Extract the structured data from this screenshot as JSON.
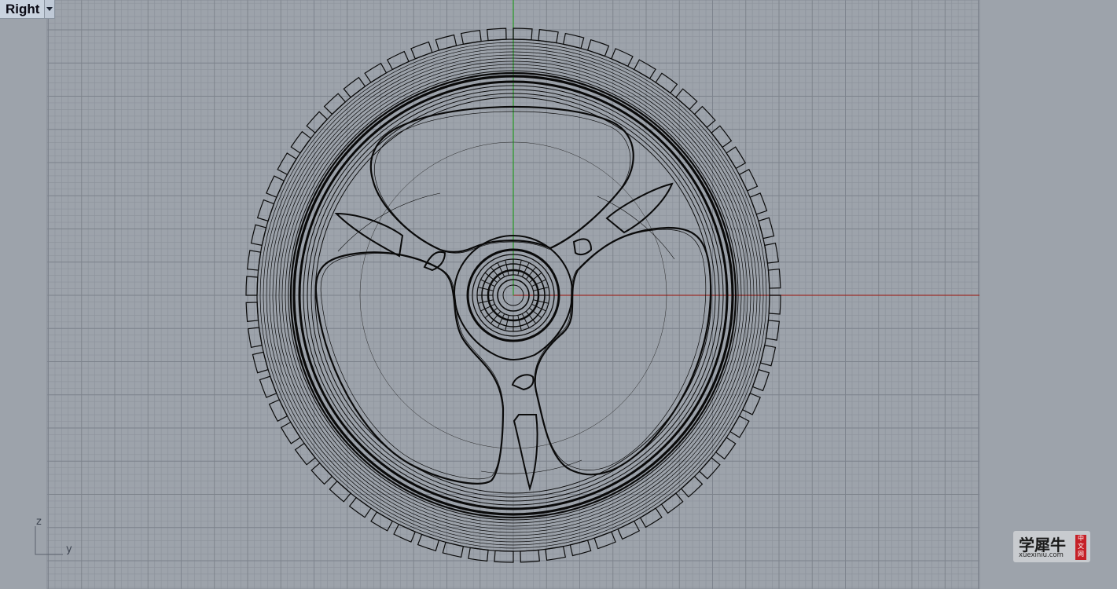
{
  "viewport": {
    "name": "Right",
    "background": "#9da3ab",
    "grid_minor_color": "#8e949d",
    "grid_major_color": "#7c828b",
    "x_axis_color": "#9b2f2a",
    "y_axis_color": "#2f9a2f"
  },
  "axes_widget": {
    "z_label": "z",
    "y_label": "y"
  },
  "watermark": {
    "chinese": "学犀牛",
    "url": "xuexiniu.com",
    "badge": "中文网"
  },
  "model": {
    "spokes": 3,
    "description_icon": "wheel-wireframe"
  }
}
